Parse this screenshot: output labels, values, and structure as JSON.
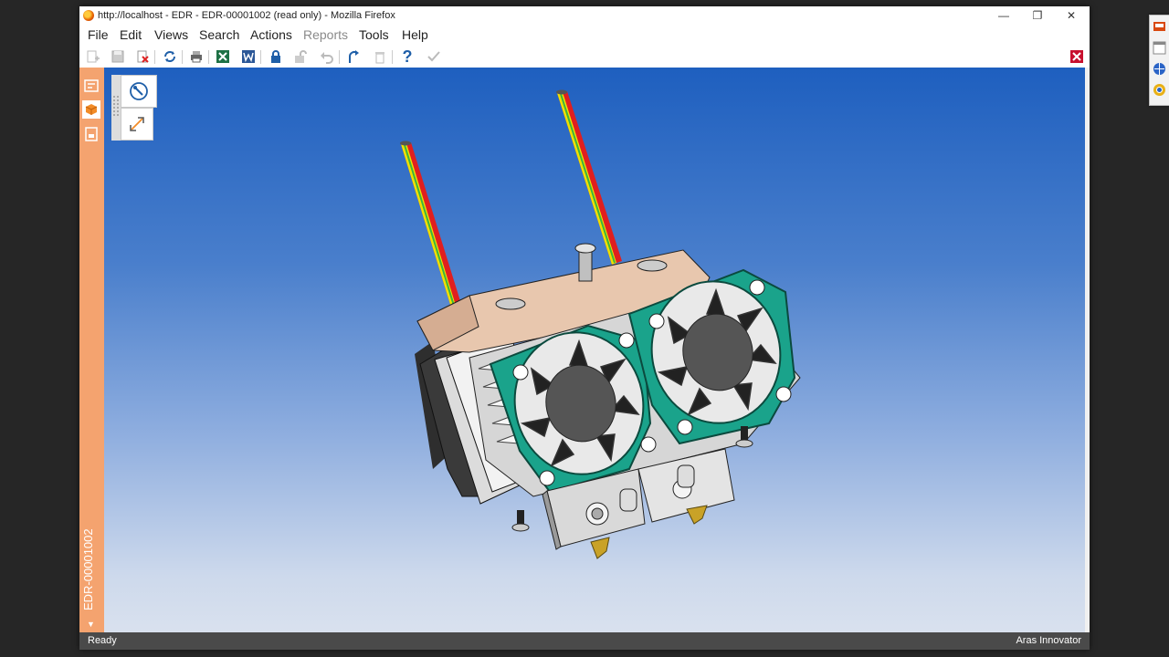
{
  "window": {
    "title": "http://localhost - EDR - EDR-00001002 (read only) - Mozilla Firefox",
    "controls": {
      "minimize": "—",
      "restore": "❐",
      "close": "✕"
    }
  },
  "menu": {
    "file": "File",
    "edit": "Edit",
    "views": "Views",
    "search": "Search",
    "actions": "Actions",
    "reports": "Reports",
    "tools": "Tools",
    "help": "Help"
  },
  "toolbar": {
    "help_glyph": "?"
  },
  "sidebar": {
    "item_label": "EDR-00001002",
    "collapse_glyph": "▼"
  },
  "status": {
    "left": "Ready",
    "right": "Aras Innovator"
  },
  "colors": {
    "accent": "#f4a36f",
    "status_bar": "#4a4a4a",
    "viewport_top": "#1e5fbf",
    "viewport_bottom": "#d9e1ee",
    "fan_teal": "#1aa38b",
    "heat_block": "#e8c7ae"
  }
}
